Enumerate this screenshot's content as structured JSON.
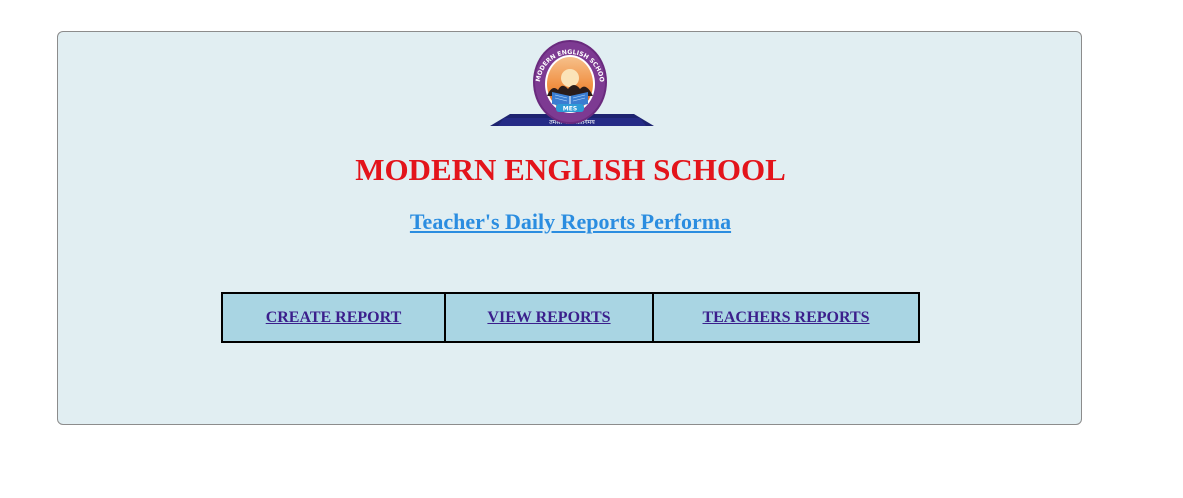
{
  "logo": {
    "ring_text": "MODERN ENGLISH SCHOOL, NAWADA",
    "badge": "MES",
    "motto": "तमसो मा ज्योतिर्गमय"
  },
  "header": {
    "school_name": "MODERN ENGLISH SCHOOL",
    "subtitle": "Teacher's Daily Reports Performa"
  },
  "nav": {
    "items": [
      {
        "label": "CREATE REPORT"
      },
      {
        "label": "VIEW REPORTS"
      },
      {
        "label": "TEACHERS REPORTS"
      }
    ]
  },
  "colors": {
    "panel_bg": "#e1eef2",
    "title_red": "#e3141b",
    "subtitle_blue": "#2b8de0",
    "nav_cell_bg": "#a9d5e3",
    "nav_link": "#3b1f8c"
  }
}
